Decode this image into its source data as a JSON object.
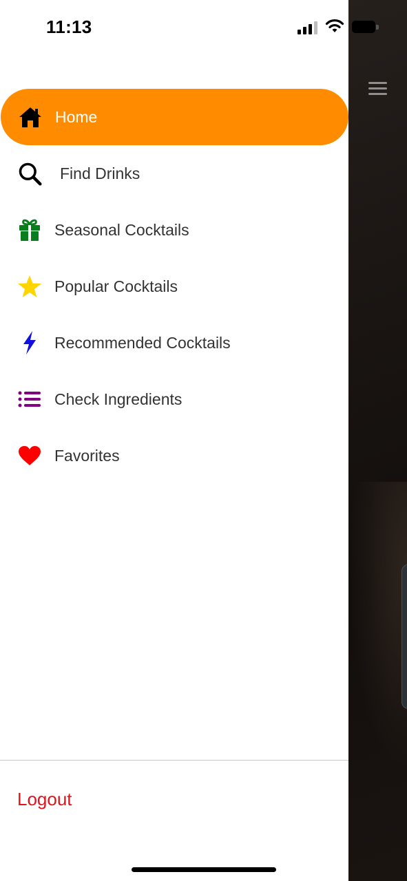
{
  "status_bar": {
    "time": "11:13"
  },
  "menu": {
    "items": [
      {
        "label": "Home",
        "icon": "home-icon",
        "active": true
      },
      {
        "label": "Find Drinks",
        "icon": "search-icon",
        "active": false
      },
      {
        "label": "Seasonal Cocktails",
        "icon": "gift-icon",
        "active": false
      },
      {
        "label": "Popular Cocktails",
        "icon": "star-icon",
        "active": false
      },
      {
        "label": "Recommended Cocktails",
        "icon": "bolt-icon",
        "active": false
      },
      {
        "label": "Check Ingredients",
        "icon": "list-icon",
        "active": false
      },
      {
        "label": "Favorites",
        "icon": "heart-icon",
        "active": false
      }
    ]
  },
  "footer": {
    "logout_label": "Logout"
  },
  "colors": {
    "accent": "#ff8c00",
    "logout": "#e0141e",
    "gift": "#0a7d1c",
    "star": "#ffd500",
    "bolt": "#1010e0",
    "list": "#800080",
    "heart": "#ff0000"
  }
}
